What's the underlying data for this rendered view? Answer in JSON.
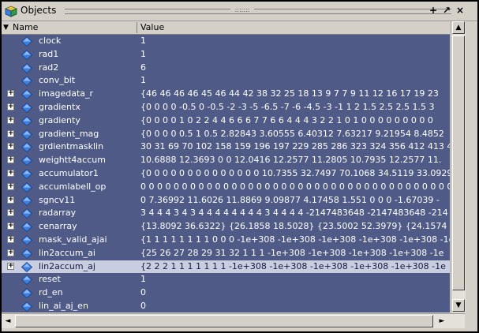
{
  "window": {
    "title": "Objects",
    "grip": ":::::::",
    "buttons": {
      "add": "+",
      "undock": "↗",
      "close": "×"
    },
    "icon": "objects-pane-icon"
  },
  "header": {
    "name_col": "Name",
    "value_col": "Value"
  },
  "colors": {
    "tree_bg": "#4f5b86",
    "selected_bg": "#c8cde0",
    "signal_icon": "#3b7fe0"
  },
  "rows": [
    {
      "name": "clock",
      "value": "1",
      "expandable": false
    },
    {
      "name": "rad1",
      "value": "1",
      "expandable": false
    },
    {
      "name": "rad2",
      "value": "6",
      "expandable": false
    },
    {
      "name": "conv_bit",
      "value": "1",
      "expandable": false
    },
    {
      "name": "imagedata_r",
      "value": "{46 46 46 46 45 46 44 42 38 32 25 18 13 9 7 7 9 11 12 16 17 19 23",
      "expandable": true
    },
    {
      "name": "gradientx",
      "value": "{0 0 0 0 -0.5 0 -0.5 -2 -3 -5 -6.5 -7 -6 -4.5 -3 -1 1 2 1.5 2.5 2.5 1.5 3",
      "expandable": true
    },
    {
      "name": "gradienty",
      "value": "{0 0 0 0 1 0 2 2 4 4 6 6 6 7 7 6 6 4 4 4 3 2 2 1 0 1 0 0 0 0 0 0 0 0 0",
      "expandable": true
    },
    {
      "name": "gradient_mag",
      "value": "{0 0 0 0 0.5 1 0.5 2.82843 3.60555 6.40312 7.63217 9.21954 8.4852",
      "expandable": true
    },
    {
      "name": "grdientmasklin",
      "value": "30 31 69 70 102 158 159 196 197 229 285 286 323 324 356 412 413 4",
      "expandable": true
    },
    {
      "name": "weightt4accum",
      "value": "10.6888 12.3693 0 0 12.0416 12.2577 11.2805 10.7935 12.2577 11.",
      "expandable": true
    },
    {
      "name": "accumulator1",
      "value": "{0 0 0 0 0 0 0 0 0 0 0 0 0 0 10.7355 32.7497 70.1068 34.5119 33.0929",
      "expandable": true
    },
    {
      "name": "accumlabell_op",
      "value": "0 0 0 0 0 0 0 0 0 0 0 0 0 0 0 0 0 0 0 0 0 0 0 0 0 0 0 0 0 0 0 0 0 0 0 0 0 0 0 0",
      "expandable": true
    },
    {
      "name": "sgncv11",
      "value": "0 7.36992 11.6026 11.8869 9.09877 4.17458 1.551 0 0 0 -1.67039 -",
      "expandable": true
    },
    {
      "name": "radarray",
      "value": "3 4 4 4 3 4 3 4 4 4 4 4 4 4 4 3 4 4 4 4 -2147483648 -2147483648 -214",
      "expandable": true
    },
    {
      "name": "cenarray",
      "value": "{13.8092 36.6322} {26.1858 18.5028} {23.5002 52.3979} {24.1574",
      "expandable": true
    },
    {
      "name": "mask_valid_ajai",
      "value": "{1 1 1 1 1 1 1 1 0 0 0 -1e+308 -1e+308 -1e+308 -1e+308 -1e+308 -1e",
      "expandable": true
    },
    {
      "name": "lin2accum_ai",
      "value": "{25 26 27 28 29 31 32 1 1 1 -1e+308 -1e+308 -1e+308 -1e+308 -1e",
      "expandable": true
    },
    {
      "name": "lin2accum_aj",
      "value": "{2 2 2 1 1 1 1 1 1 1 -1e+308 -1e+308 -1e+308 -1e+308 -1e+308 -1e",
      "expandable": true,
      "selected": true
    },
    {
      "name": "reset",
      "value": "1",
      "expandable": false
    },
    {
      "name": "rd_en",
      "value": "0",
      "expandable": false
    },
    {
      "name": "lin_ai_aj_en",
      "value": "0",
      "expandable": false
    }
  ]
}
